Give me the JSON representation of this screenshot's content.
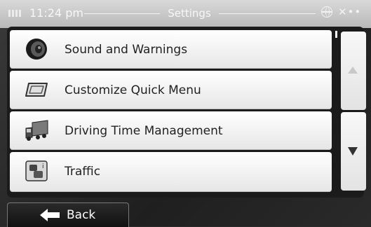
{
  "status_bar": {
    "time": "11:24 pm",
    "title": "Settings"
  },
  "menu": {
    "items": [
      {
        "label": "Sound and Warnings",
        "icon": "speaker-icon"
      },
      {
        "label": "Customize Quick Menu",
        "icon": "quick-menu-icon"
      },
      {
        "label": "Driving Time Management",
        "icon": "truck-icon"
      },
      {
        "label": "Traffic",
        "icon": "traffic-icon"
      }
    ]
  },
  "scroll": {
    "up_icon": "triangle-up-icon",
    "down_icon": "triangle-down-icon"
  },
  "footer": {
    "back_label": "Back"
  }
}
